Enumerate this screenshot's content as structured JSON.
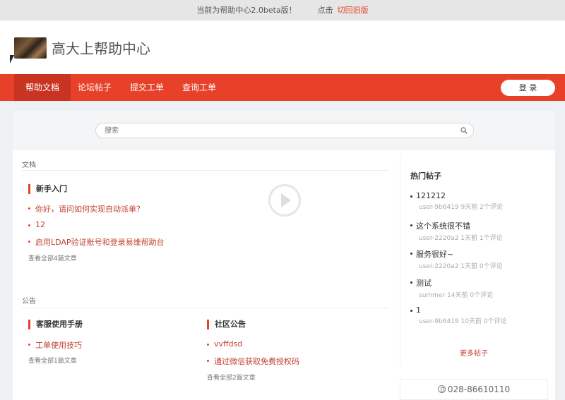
{
  "topbar": {
    "notice": "当前为帮助中心2.0beta版！",
    "prompt": "点击",
    "switch_link": "切回旧版"
  },
  "header": {
    "site_title": "高大上帮助中心"
  },
  "nav": {
    "items": [
      {
        "label": "帮助文档"
      },
      {
        "label": "论坛帖子"
      },
      {
        "label": "提交工单"
      },
      {
        "label": "查询工单"
      }
    ],
    "login_label": "登 录"
  },
  "search": {
    "placeholder": "搜索"
  },
  "docs": {
    "section_label": "文档",
    "category": "新手入门",
    "links": [
      "你好，请问如何实现自动派单？",
      "12",
      "启用LDAP验证账号和登录易维帮助台"
    ],
    "view_all": "查看全部4篇文章"
  },
  "announcements": {
    "section_label": "公告",
    "left": {
      "category": "客服使用手册",
      "links": [
        "工单使用技巧"
      ],
      "view_all": "查看全部1篇文章"
    },
    "right": {
      "category": "社区公告",
      "links": [
        "vvffdsd",
        "通过微信获取免费授权码"
      ],
      "view_all": "查看全部2篇文章"
    }
  },
  "sidebar": {
    "title": "热门帖子",
    "posts": [
      {
        "title": "121212",
        "meta": "user-9b6419 9天前 2个评论"
      },
      {
        "title": "这个系统很不错",
        "meta": "user-2220a2 1天前 1个评论"
      },
      {
        "title": "服务很好~",
        "meta": "user-2220a2 1天前 0个评论"
      },
      {
        "title": "测试",
        "meta": "summer 14天前 0个评论"
      },
      {
        "title": "1",
        "meta": "user-9b6419 10天前 0个评论"
      }
    ],
    "more_label": "更多帖子"
  },
  "contact": {
    "phone": "028-86610110"
  },
  "colors": {
    "accent": "#e8412a",
    "nav_active": "#c93422",
    "link": "#c2412e"
  }
}
